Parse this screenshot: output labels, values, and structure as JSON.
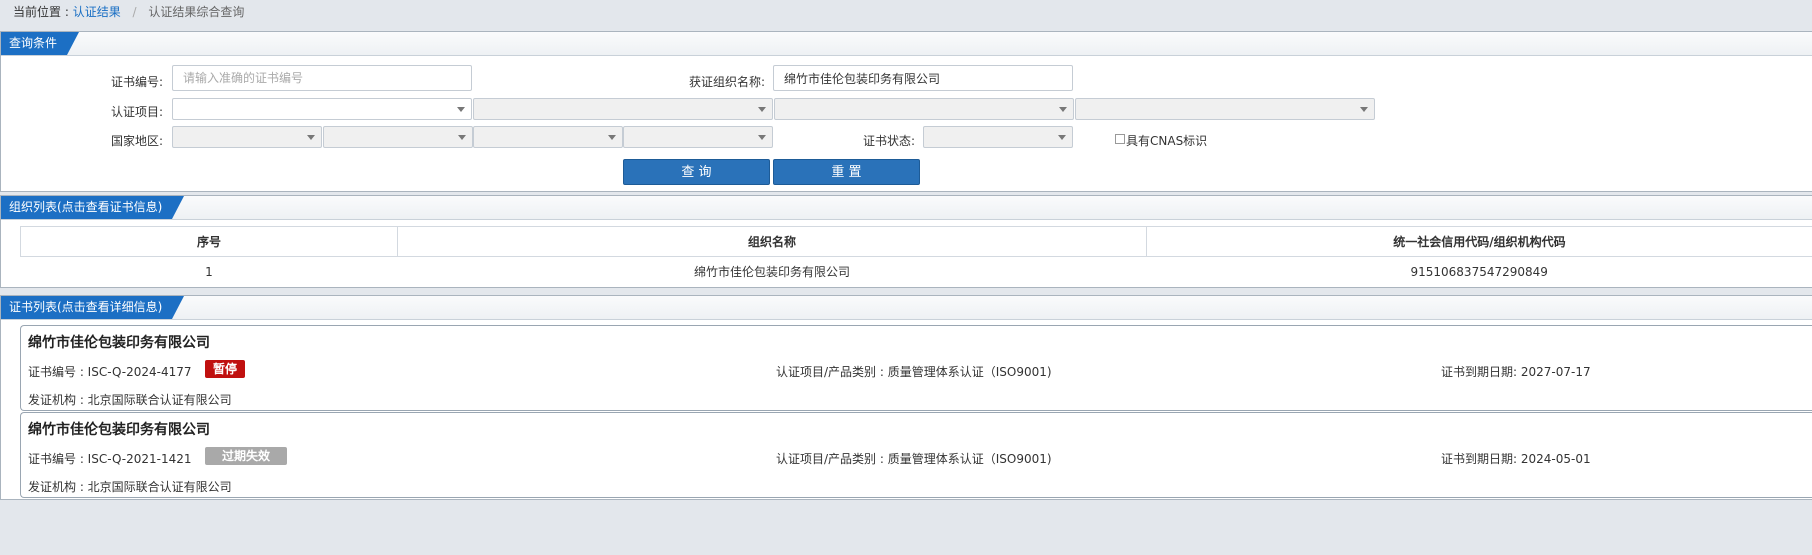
{
  "breadcrumb": {
    "prefix": "当前位置 :",
    "link": "认证结果",
    "separator": "/",
    "current": "认证结果综合查询"
  },
  "query": {
    "title": "查询条件",
    "cert_no_label": "证书编号:",
    "cert_no_placeholder": "请输入准确的证书编号",
    "cert_no_value": "",
    "org_name_label": "获证组织名称:",
    "org_name_value": "绵竹市佳伦包装印务有限公司",
    "project_label": "认证项目:",
    "region_label": "国家地区:",
    "status_label": "证书状态:",
    "cnas_label": "具有CNAS标识",
    "cnas_checked": false,
    "search_button": "查 询",
    "reset_button": "重 置"
  },
  "org_list": {
    "title": "组织列表(点击查看证书信息)",
    "columns": [
      "序号",
      "组织名称",
      "统一社会信用代码/组织机构代码"
    ],
    "rows": [
      {
        "index": "1",
        "name": "绵竹市佳伦包装印务有限公司",
        "code": "915106837547290849"
      }
    ]
  },
  "cert_list": {
    "title": "证书列表(点击查看详细信息)",
    "items": [
      {
        "org_name": "绵竹市佳伦包装印务有限公司",
        "cert_no": "证书编号 : ISC-Q-2024-4177",
        "status": "暂停",
        "status_color": "#c0100f",
        "project": "认证项目/产品类别 : 质量管理体系认证（ISO9001)",
        "expiry": "证书到期日期: 2027-07-17",
        "issuer": "发证机构 : 北京国际联合认证有限公司"
      },
      {
        "org_name": "绵竹市佳伦包装印务有限公司",
        "cert_no": "证书编号 : ISC-Q-2021-1421",
        "status": "过期失效",
        "status_color": "#a9a9a9",
        "project": "认证项目/产品类别 : 质量管理体系认证（ISO9001)",
        "expiry": "证书到期日期: 2024-05-01",
        "issuer": "发证机构 : 北京国际联合认证有限公司"
      }
    ]
  },
  "colors": {
    "accent": "#1c6fc4",
    "button": "#2a72b9",
    "background": "#e3e7ec"
  }
}
